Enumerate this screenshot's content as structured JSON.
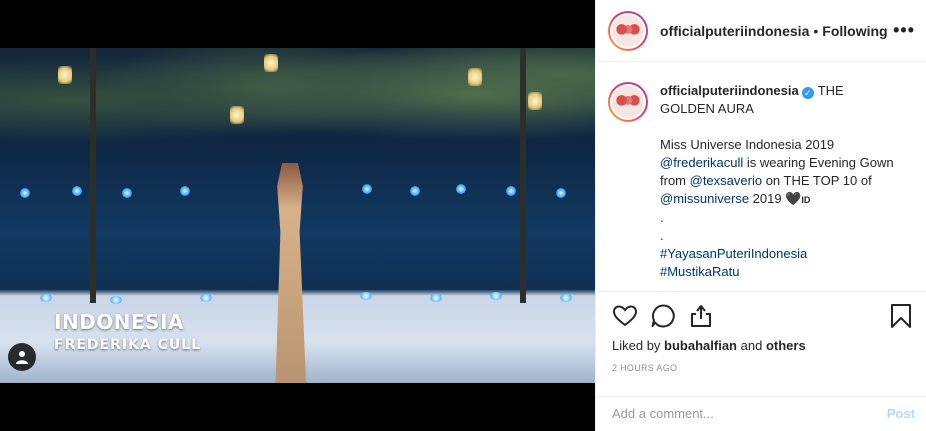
{
  "video": {
    "country": "INDONESIA",
    "contestant": "FREDERIKA CULL"
  },
  "header": {
    "username": "officialputeriindonesia",
    "separator": "•",
    "follow_status": "Following",
    "more_label": "•••"
  },
  "caption": {
    "username": "officialputeriindonesia",
    "verified_mark": "✓",
    "title": "THE GOLDEN AURA",
    "line1": "Miss Universe Indonesia 2019",
    "mention1": "@frederikacull",
    "text2": " is wearing Evening Gown from ",
    "mention2": "@texsaverio",
    "text3": " on THE TOP 10 of ",
    "mention3": "@missuniverse",
    "text4": " 2019 🖤",
    "flag_text": "ID",
    "dot1": ".",
    "dot2": ".",
    "hashtag1": "#YayasanPuteriIndonesia",
    "hashtag2": "#MustikaRatu"
  },
  "likes": {
    "prefix": "Liked by",
    "user": "bubahalfian",
    "and": "and",
    "others": "others"
  },
  "timestamp": "2 HOURS AGO",
  "comment": {
    "placeholder": "Add a comment...",
    "post_label": "Post"
  },
  "icons": [
    "heart-icon",
    "comment-icon",
    "share-icon",
    "bookmark-icon",
    "user-tag-icon",
    "more-icon",
    "verified-icon"
  ]
}
